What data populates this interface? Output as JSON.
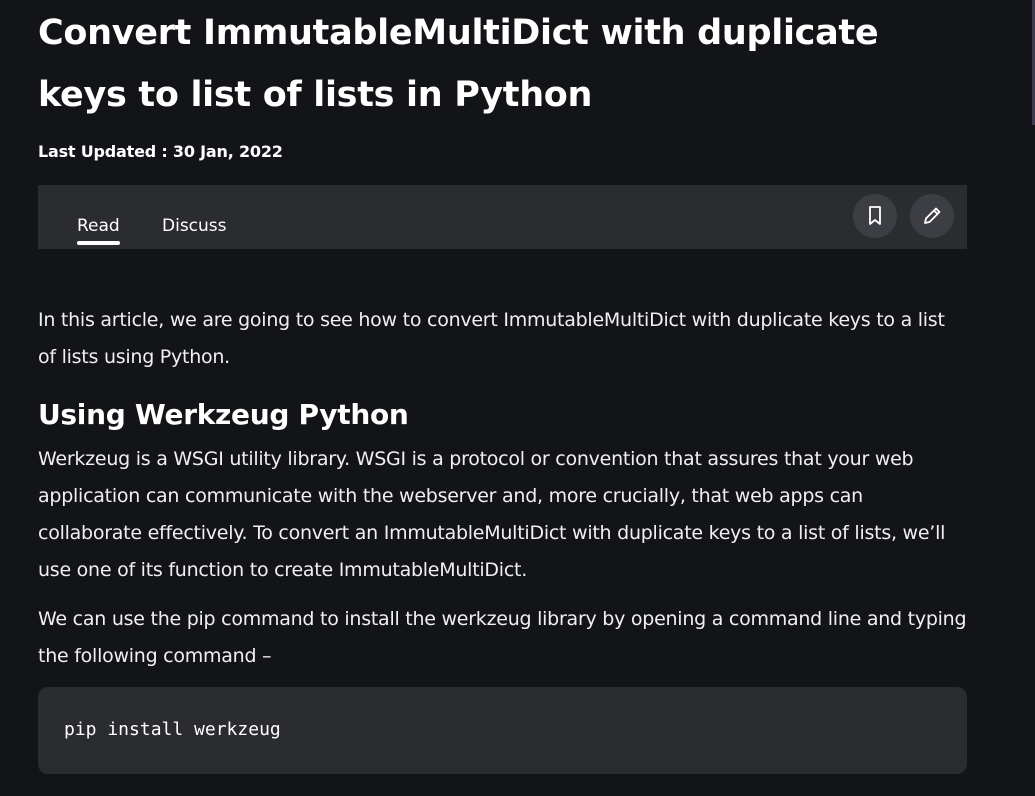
{
  "article": {
    "title": "Convert ImmutableMultiDict with duplicate keys to list of lists in Python",
    "last_updated": "Last Updated : 30 Jan, 2022"
  },
  "tabs": {
    "read": "Read",
    "discuss": "Discuss"
  },
  "actions": {
    "bookmark_icon": "bookmark-icon",
    "edit_icon": "pencil-icon"
  },
  "content": {
    "intro": "In this article, we are going to see how to convert ImmutableMultiDict with duplicate keys to a list of lists using Python.",
    "heading": "Using Werkzeug Python",
    "paragraph1": "Werkzeug is a WSGI utility library. WSGI is a protocol or convention that assures that your web application can communicate with the webserver and, more crucially, that web apps can collaborate effectively. To convert an ImmutableMultiDict with duplicate keys to a list of lists, we’ll use one of its function to create ImmutableMultiDict.",
    "paragraph2": "We can use the pip command to install the werkzeug library by opening a command line and typing the following command –",
    "code": "pip install werkzeug"
  },
  "colors": {
    "background": "#131417",
    "panel": "#2b2c30",
    "text": "#f0f0f0"
  }
}
